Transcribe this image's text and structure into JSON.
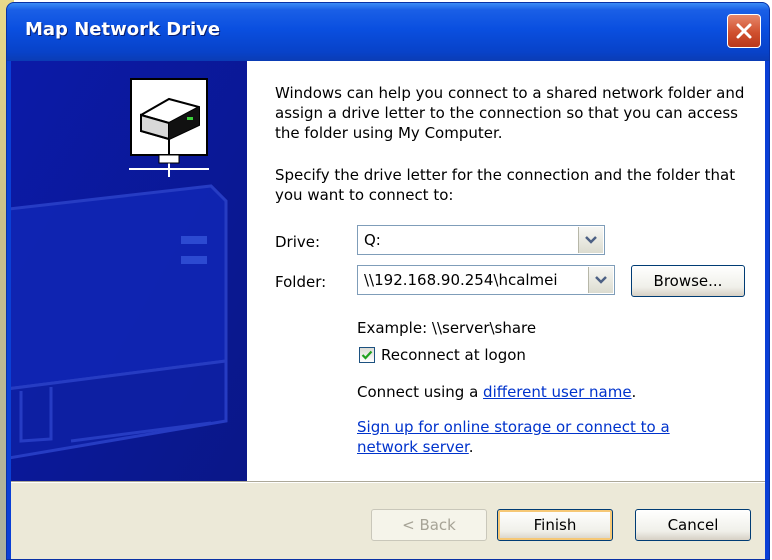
{
  "window": {
    "title": "Map Network Drive"
  },
  "intro": {
    "text": "Windows can help you connect to a shared network folder and assign a drive letter to the connection so that you can access the folder using My Computer."
  },
  "instruction": {
    "text": "Specify the drive letter for the connection and the folder that you want to connect to:"
  },
  "drive": {
    "label": "Drive:",
    "value": "Q:"
  },
  "folder": {
    "label": "Folder:",
    "value": "\\\\192.168.90.254\\hcalmei",
    "browse_label": "Browse..."
  },
  "example": {
    "text": "Example: \\\\server\\share"
  },
  "reconnect": {
    "label": "Reconnect at logon",
    "checked": true
  },
  "connect_as": {
    "prefix": "Connect using a ",
    "link": "different user name",
    "suffix": "."
  },
  "signup": {
    "link": "Sign up for online storage or connect to a network server",
    "suffix": "."
  },
  "buttons": {
    "back": "< Back",
    "finish": "Finish",
    "cancel": "Cancel"
  },
  "colors": {
    "titlebar": "#0a4fe0",
    "side_panel": "#0b1aa8",
    "dialog_face": "#ece9d8",
    "link": "#0033cc",
    "close_button": "#d0502e"
  },
  "icons": {
    "close": "close-icon",
    "dropdown": "chevron-down-icon",
    "check": "check-icon",
    "network_drive": "network-drive-icon"
  }
}
